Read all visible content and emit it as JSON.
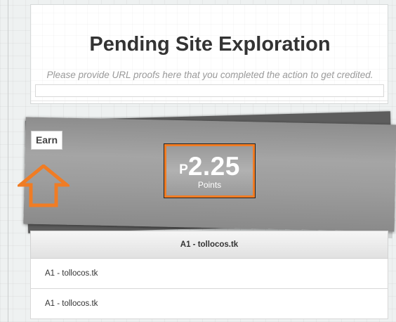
{
  "header": {
    "title": "Pending Site Exploration",
    "subtitle": "Please provide URL proofs here that you completed the action to get credited.",
    "url_input_value": ""
  },
  "earn": {
    "label": "Earn",
    "icon": "up-arrow-icon",
    "points_prefix": "P",
    "points_value": "2.25",
    "points_unit": "Points"
  },
  "sites": {
    "header": "A1 - tollocos.tk",
    "items": [
      {
        "label": "A1 - tollocos.tk"
      },
      {
        "label": "A1 - tollocos.tk"
      }
    ]
  },
  "colors": {
    "accent_orange": "#f07c24",
    "panel_gray": "#9d9d9d",
    "title_text": "#333333"
  }
}
